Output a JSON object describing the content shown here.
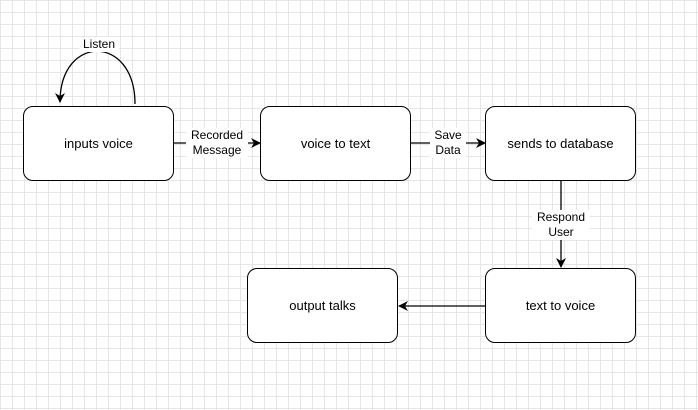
{
  "nodes": {
    "inputs_voice": "inputs voice",
    "voice_to_text": "voice to text",
    "sends_to_database": "sends to database",
    "text_to_voice": "text to voice",
    "output_talks": "output talks"
  },
  "edges": {
    "listen": "Listen",
    "recorded_message_line1": "Recorded",
    "recorded_message_line2": "Message",
    "save_data_line1": "Save",
    "save_data_line2": "Data",
    "respond_user_line1": "Respond",
    "respond_user_line2": "User"
  },
  "colors": {
    "grid": "#e6e6e6",
    "stroke": "#000000",
    "fill": "#ffffff"
  }
}
